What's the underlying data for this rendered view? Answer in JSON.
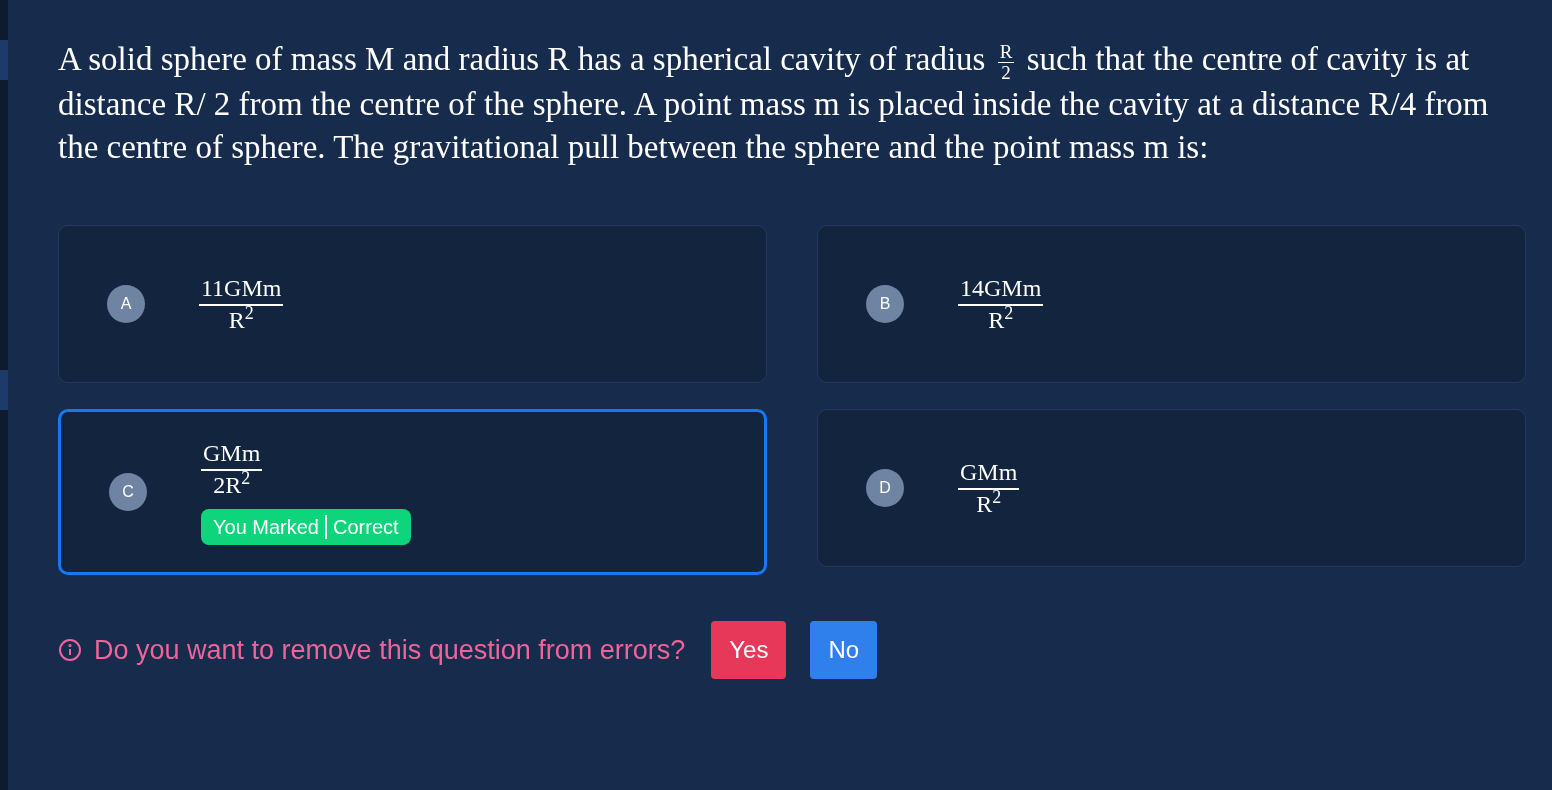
{
  "question": {
    "text_before": "A solid sphere of mass M and radius R has a spherical cavity of radius",
    "fraction": {
      "numerator": "R",
      "denominator": "2"
    },
    "text_after": "such that the centre of cavity is at distance R/ 2 from the centre of the sphere. A point mass m is placed inside the cavity at a distance R/4 from the centre of sphere. The gravitational pull between the sphere and the point mass m is:"
  },
  "options": [
    {
      "letter": "A",
      "numerator": "11GMm",
      "denominator": "R$^{2}$",
      "selected": false
    },
    {
      "letter": "B",
      "numerator": "14GMm",
      "denominator": "R$^{2}$",
      "selected": false
    },
    {
      "letter": "C",
      "numerator": "GMm",
      "denominator": "2R$^{2}$",
      "selected": true,
      "badge": [
        "You Marked",
        "Correct"
      ]
    },
    {
      "letter": "D",
      "numerator": "GMm",
      "denominator": "R$^{2}$",
      "selected": false
    }
  ],
  "prompt": {
    "text": "Do you want to remove this question from errors?",
    "buttons": [
      {
        "label": "Yes",
        "kind": "confirm"
      },
      {
        "label": "No",
        "kind": "cancel"
      }
    ]
  }
}
